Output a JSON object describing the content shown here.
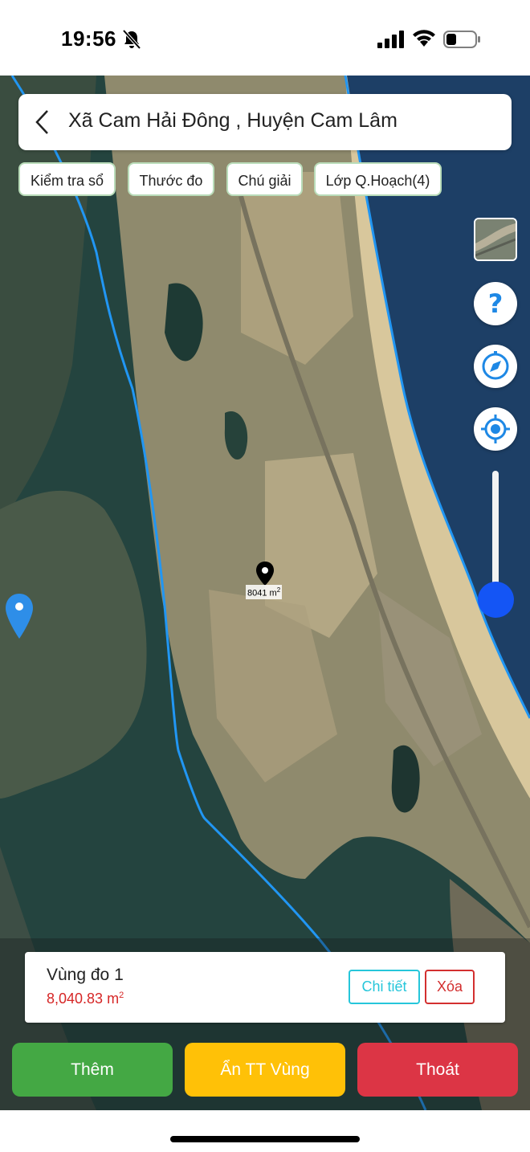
{
  "status_bar": {
    "time": "19:56",
    "icons": [
      "bell-slash-icon",
      "signal-icon",
      "wifi-icon",
      "battery-icon"
    ]
  },
  "header": {
    "title": "Xã Cam Hải Đông , Huyện Cam Lâm",
    "back_icon": "chevron-left-icon"
  },
  "chips": [
    {
      "label": "Kiểm tra sổ"
    },
    {
      "label": "Thước đo"
    },
    {
      "label": "Chú giải"
    },
    {
      "label": "Lớp Q.Hoạch(4)"
    }
  ],
  "map": {
    "marker_label": "8041 m",
    "marker_sup": "2",
    "right_controls": [
      "layer-thumbnail",
      "help-icon",
      "compass-icon",
      "locate-icon"
    ],
    "zoom_level": 0.1
  },
  "measure_card": {
    "title": "Vùng đo 1",
    "area_value": "8,040.83 m",
    "area_sup": "2",
    "detail_label": "Chi tiết",
    "delete_label": "Xóa"
  },
  "actions": {
    "add_label": "Thêm",
    "hide_label": "Ẩn TT Vùng",
    "exit_label": "Thoát"
  },
  "colors": {
    "accent_blue": "#1455f5",
    "green": "#44a844",
    "yellow": "#ffc107",
    "red": "#dc3545",
    "boundary": "#2196f3"
  }
}
